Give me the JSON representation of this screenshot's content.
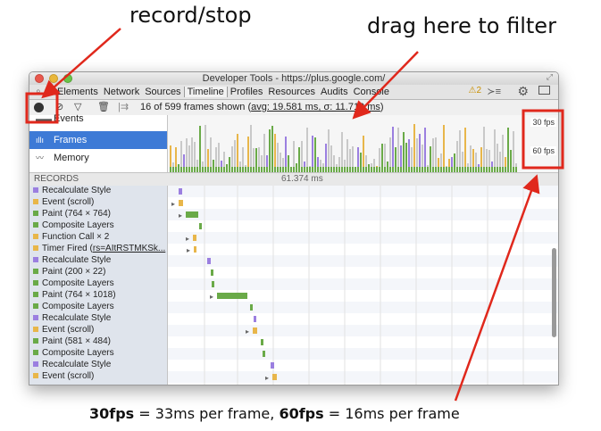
{
  "annotations": {
    "record_stop": "record/stop",
    "drag_filter": "drag here to filter",
    "fps_30_bold": "30fps",
    "fps_30_rest": " = 33ms per frame, ",
    "fps_60_bold": "60fps",
    "fps_60_rest": " = 16ms per frame"
  },
  "window": {
    "title": "Developer Tools - https://plus.google.com/",
    "warning_count": "2"
  },
  "tabs": [
    "Elements",
    "Network",
    "Sources",
    "Timeline",
    "Profiles",
    "Resources",
    "Audits",
    "Console"
  ],
  "active_tab": "Timeline",
  "toolbar": {
    "frames_shown": "16 of 599 frames shown (",
    "stats": "avg: 19.581 ms, σ: 11.710 ms",
    "close_paren": ")"
  },
  "sidebar": {
    "events": "Events",
    "frames": "Frames",
    "memory": "Memory"
  },
  "overview": {
    "fps30": "30 fps",
    "fps60": "60 fps"
  },
  "records_header": "RECORDS",
  "time_label": "61.374 ms",
  "colors": {
    "rendering": "#9b7fe0",
    "scripting": "#e8b64a",
    "painting": "#6aaa48",
    "selected": "#3d7ad6"
  },
  "records": [
    {
      "label": "Recalculate Style",
      "category": "rendering"
    },
    {
      "label": "Event (scroll)",
      "category": "scripting"
    },
    {
      "label": "Paint (764 × 764)",
      "category": "painting"
    },
    {
      "label": "Composite Layers",
      "category": "painting"
    },
    {
      "label": "Function Call × 2",
      "category": "scripting"
    },
    {
      "label": "Timer Fired (",
      "link": "rs=AItRSTMKSk...",
      "category": "scripting"
    },
    {
      "label": "Recalculate Style",
      "category": "rendering"
    },
    {
      "label": "Paint (200 × 22)",
      "category": "painting"
    },
    {
      "label": "Composite Layers",
      "category": "painting"
    },
    {
      "label": "Paint (764 × 1018)",
      "category": "painting"
    },
    {
      "label": "Composite Layers",
      "category": "painting"
    },
    {
      "label": "Recalculate Style",
      "category": "rendering"
    },
    {
      "label": "Event (scroll)",
      "category": "scripting"
    },
    {
      "label": "Paint (581 × 484)",
      "category": "painting"
    },
    {
      "label": "Composite Layers",
      "category": "painting"
    },
    {
      "label": "Recalculate Style",
      "category": "rendering"
    },
    {
      "label": "Event (scroll)",
      "category": "scripting"
    }
  ]
}
